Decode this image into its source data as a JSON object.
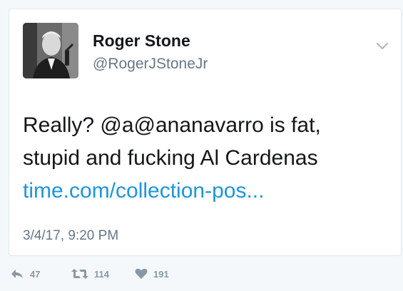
{
  "author": {
    "name": "Roger Stone",
    "handle": "@RogerJStoneJr"
  },
  "tweet": {
    "line1": "Really?  @a@ananavarro is fat,",
    "line2": "stupid and fucking Al Cardenas",
    "link": "time.com/collection-pos...",
    "timestamp": "3/4/17, 9:20 PM"
  },
  "actions": {
    "reply_count": "47",
    "retweet_count": "114",
    "like_count": "191"
  },
  "icons": {
    "menu": "chevron-down-icon",
    "reply": "reply-icon",
    "retweet": "retweet-icon",
    "like": "heart-icon"
  },
  "colors": {
    "link": "#1b95e0",
    "muted": "#657786",
    "action": "#8899a6",
    "text": "#14171a"
  }
}
